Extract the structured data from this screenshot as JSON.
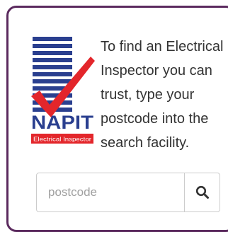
{
  "intro": {
    "lines": [
      "To find an Electrical",
      "Inspector you can",
      "trust, type your",
      "postcode into the",
      "search facility."
    ]
  },
  "logo": {
    "wordmark": "NAPIT",
    "subtitle": "Electrical Inspector"
  },
  "search": {
    "placeholder": "postcode",
    "value": "",
    "icon": "search-icon"
  },
  "colors": {
    "border": "#5b2a5e",
    "logo_blue": "#2a3f8f",
    "logo_red": "#e3262b",
    "text": "#333333"
  }
}
